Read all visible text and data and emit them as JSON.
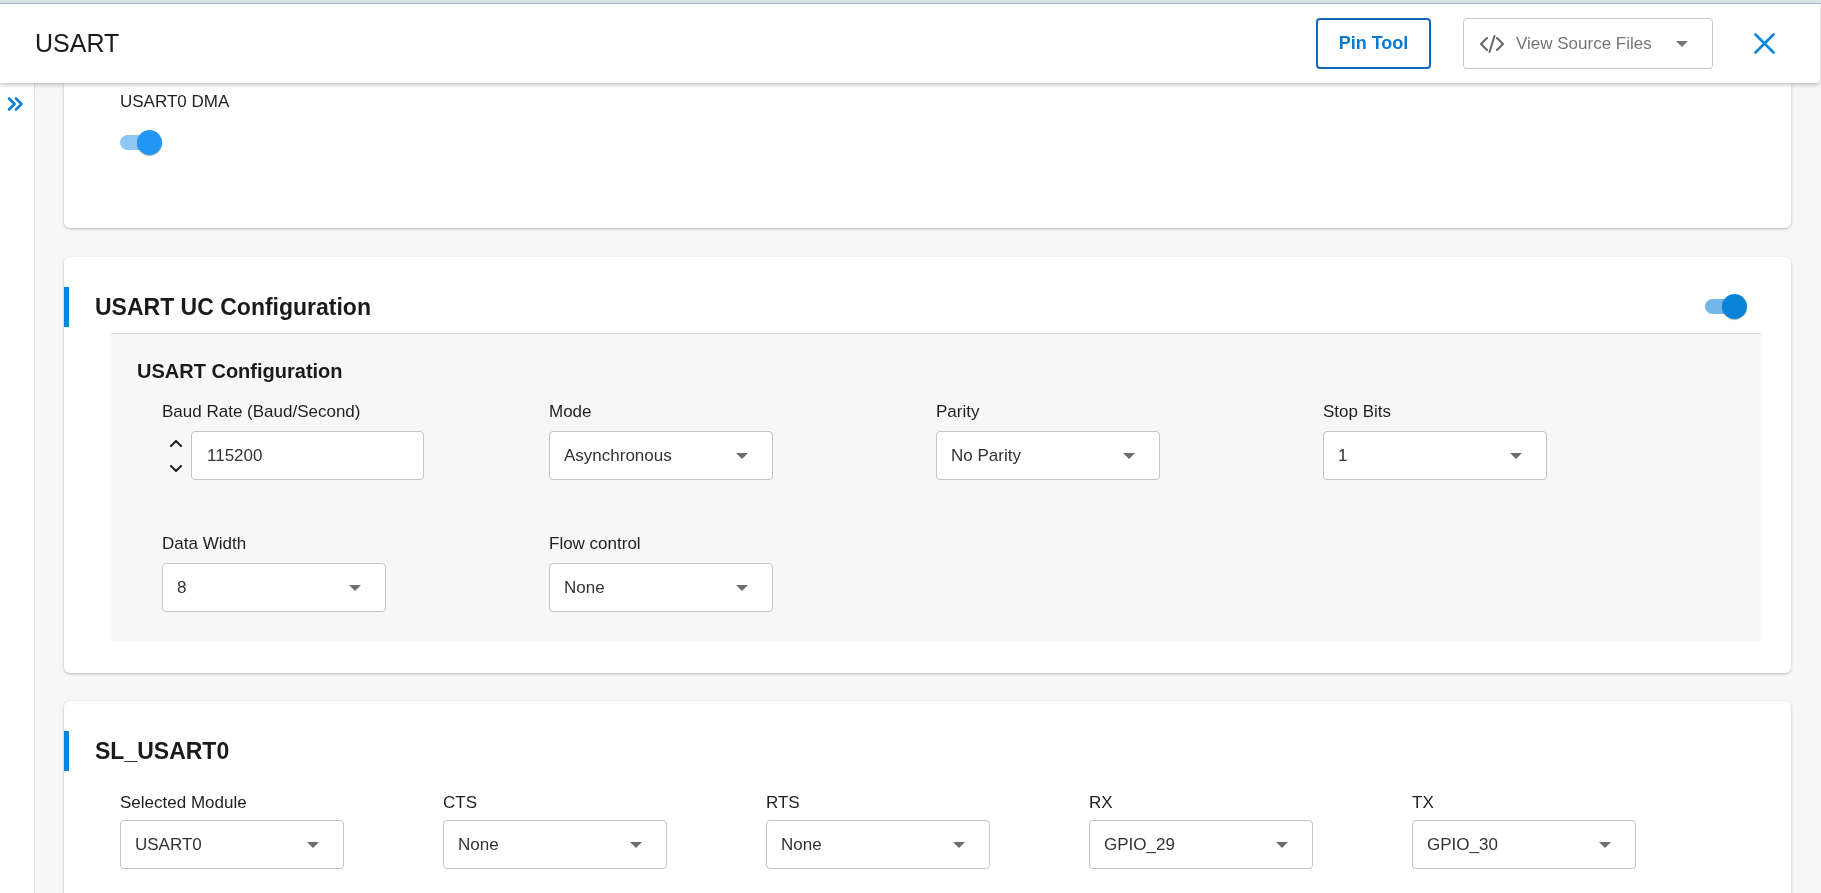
{
  "header": {
    "title": "USART",
    "pin_tool_button": "Pin Tool",
    "source_files_menu": {
      "label": "View Source Files"
    }
  },
  "dma_card": {
    "label": "USART0 DMA",
    "on": true
  },
  "uc_configuration": {
    "title": "USART UC Configuration",
    "on": true,
    "panel": {
      "title": "USART Configuration",
      "fields": [
        {
          "kind": "number",
          "label": "Baud Rate (Baud/Second)",
          "value": "115200"
        },
        {
          "kind": "select",
          "label": "Mode",
          "value": "Asynchronous"
        },
        {
          "kind": "select",
          "label": "Parity",
          "value": "No Parity"
        },
        {
          "kind": "select",
          "label": "Stop Bits",
          "value": "1"
        },
        {
          "kind": "select",
          "label": "Data Width",
          "value": "8"
        },
        {
          "kind": "select",
          "label": "Flow control",
          "value": "None"
        }
      ]
    }
  },
  "sl_usart0": {
    "title": "SL_USART0",
    "fields": [
      {
        "label": "Selected Module",
        "value": "USART0"
      },
      {
        "label": "CTS",
        "value": "None"
      },
      {
        "label": "RTS",
        "value": "None"
      },
      {
        "label": "RX",
        "value": "GPIO_29"
      },
      {
        "label": "TX",
        "value": "GPIO_30"
      }
    ]
  }
}
